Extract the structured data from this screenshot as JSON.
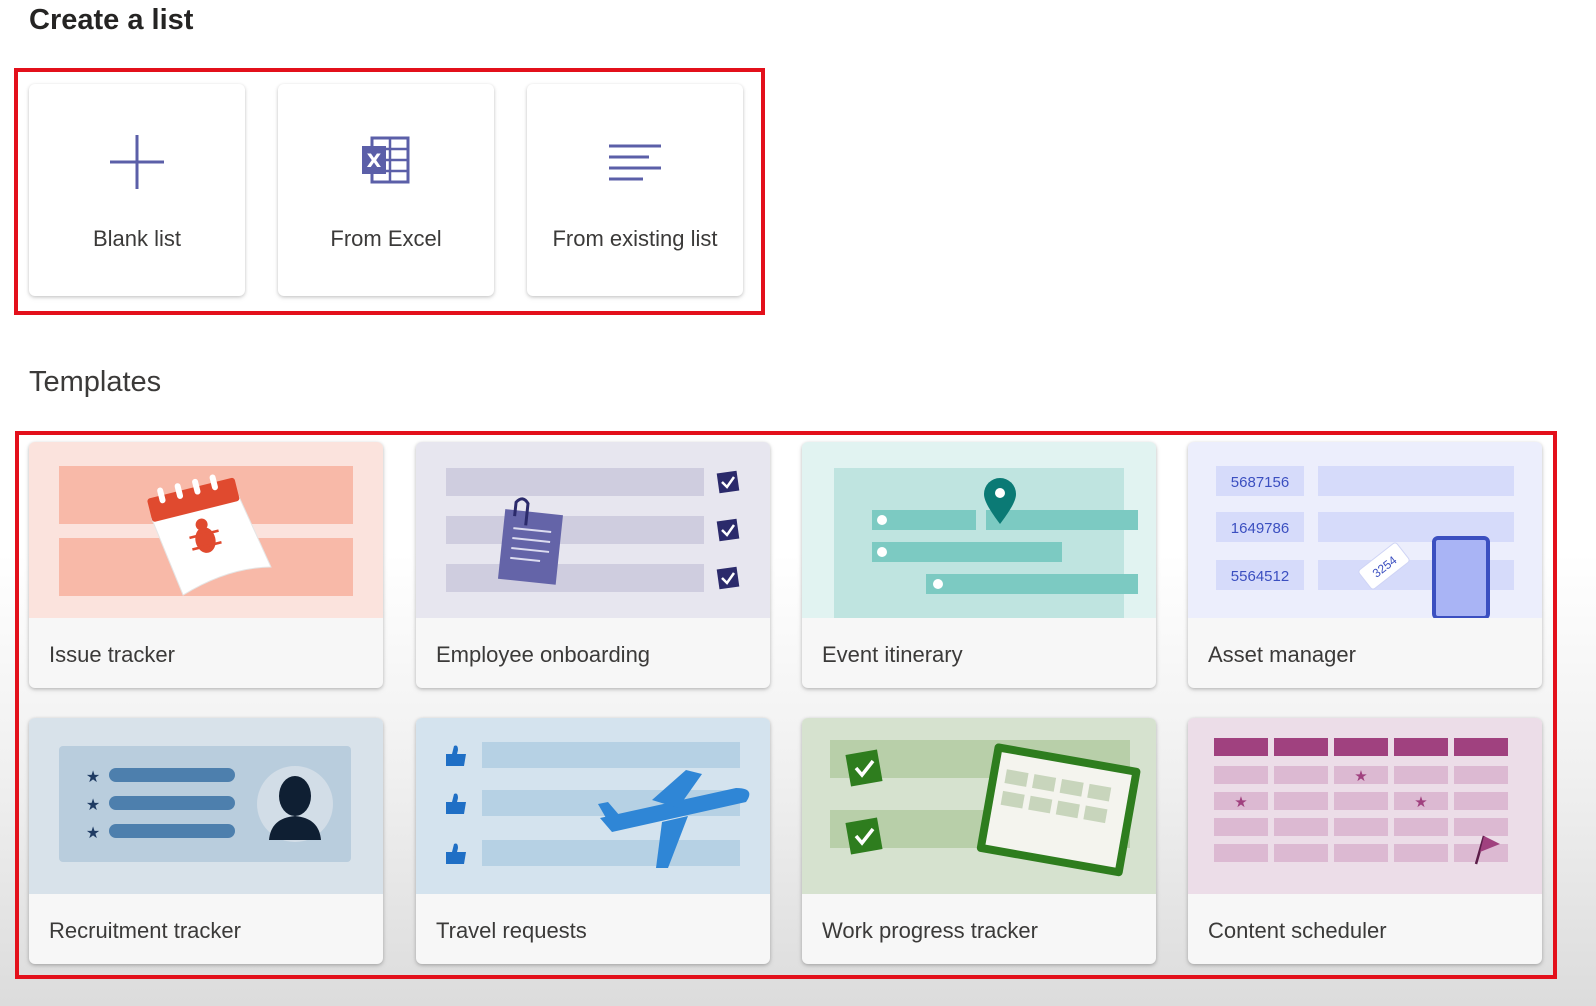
{
  "header": {
    "title": "Create a list"
  },
  "create_options": [
    {
      "label": "Blank list",
      "icon": "plus-icon"
    },
    {
      "label": "From Excel",
      "icon": "excel-icon"
    },
    {
      "label": "From existing list",
      "icon": "list-lines-icon"
    }
  ],
  "templates": {
    "title": "Templates",
    "items": [
      {
        "label": "Issue tracker"
      },
      {
        "label": "Employee onboarding"
      },
      {
        "label": "Event itinerary"
      },
      {
        "label": "Asset manager",
        "numbers": [
          "5687156",
          "1649786",
          "5564512"
        ],
        "tag": "3254"
      },
      {
        "label": "Recruitment tracker"
      },
      {
        "label": "Travel requests"
      },
      {
        "label": "Work progress tracker"
      },
      {
        "label": "Content scheduler"
      }
    ]
  },
  "colors": {
    "highlight": "#e3101b",
    "accent": "#5b5fa8"
  }
}
